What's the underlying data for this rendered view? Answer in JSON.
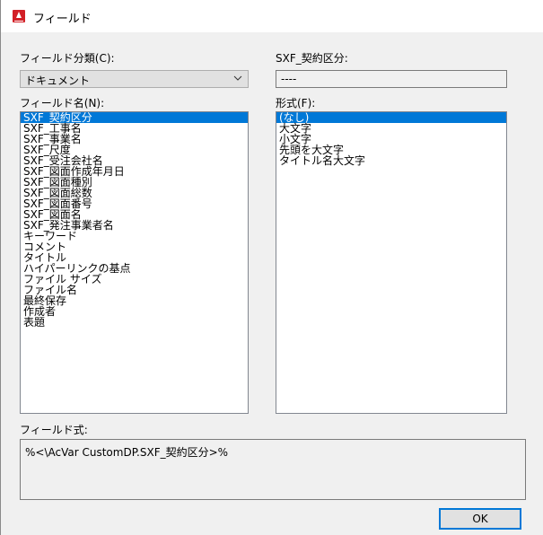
{
  "window": {
    "title": "フィールド",
    "app_icon": "autocad-logo-icon"
  },
  "category": {
    "label": "フィールド分類(C):",
    "selected": "ドキュメント"
  },
  "current_value": {
    "label": "SXF_契約区分:",
    "value": "----"
  },
  "field_names": {
    "label": "フィールド名(N):",
    "items": [
      "SXF_契約区分",
      "SXF_工事名",
      "SXF_事業名",
      "SXF_尺度",
      "SXF_受注会社名",
      "SXF_図面作成年月日",
      "SXF_図面種別",
      "SXF_図面総数",
      "SXF_図面番号",
      "SXF_図面名",
      "SXF_発注事業者名",
      "キーワード",
      "コメント",
      "タイトル",
      "ハイパーリンクの基点",
      "ファイル サイズ",
      "ファイル名",
      "最終保存",
      "作成者",
      "表題"
    ],
    "selected_index": 0
  },
  "format": {
    "label": "形式(F):",
    "items": [
      "(なし)",
      "大文字",
      "小文字",
      "先頭を大文字",
      "タイトル名大文字"
    ],
    "selected_index": 0
  },
  "expression": {
    "label": "フィールド式:",
    "value": "%<\\AcVar CustomDP.SXF_契約区分>%"
  },
  "buttons": {
    "ok": "OK"
  },
  "colors": {
    "selection": "#0078d7",
    "dialog_bg": "#f0f0f0",
    "brand": "#d21f26"
  }
}
